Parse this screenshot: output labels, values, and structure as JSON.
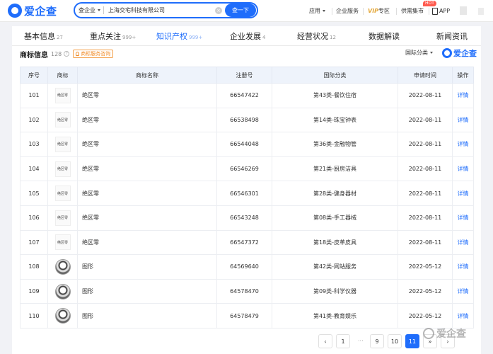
{
  "header": {
    "logo": "爱企查",
    "search_type": "查企业",
    "search_value": "上海交宅科技有限公司",
    "search_button": "查一下",
    "nav": {
      "apps": "应用",
      "enterprise_service": "企业服务",
      "vip": "VIP",
      "vip_zone": "专区",
      "supply_market": "供需集市",
      "hot_badge": "HOT",
      "app": "APP"
    }
  },
  "tabs": [
    {
      "label": "基本信息",
      "count": "27"
    },
    {
      "label": "重点关注",
      "count": "999+"
    },
    {
      "label": "知识产权",
      "count": "999+",
      "active": true
    },
    {
      "label": "企业发展",
      "count": "4"
    },
    {
      "label": "经营状况",
      "count": "12"
    },
    {
      "label": "数据解读",
      "count": ""
    },
    {
      "label": "新闻资讯",
      "count": ""
    }
  ],
  "section": {
    "title": "商标信息",
    "count": "128",
    "consult_tag": "商标服务咨询",
    "filter_label": "国际分类",
    "brand": "爱企查"
  },
  "table": {
    "columns": [
      "序号",
      "商标",
      "商标名称",
      "注册号",
      "国际分类",
      "申请时间",
      "操作"
    ],
    "rows": [
      {
        "index": "101",
        "logo_text": "绝区零",
        "logo_type": "text",
        "name": "绝区零",
        "reg_no": "66547422",
        "class": "第43类-餐饮住宿",
        "date": "2022-08-11",
        "action": "详情"
      },
      {
        "index": "102",
        "logo_text": "绝区零",
        "logo_type": "text",
        "name": "绝区零",
        "reg_no": "66538498",
        "class": "第14类-珠宝钟表",
        "date": "2022-08-11",
        "action": "详情"
      },
      {
        "index": "103",
        "logo_text": "绝区零",
        "logo_type": "text",
        "name": "绝区零",
        "reg_no": "66544048",
        "class": "第36类-金融物管",
        "date": "2022-08-11",
        "action": "详情"
      },
      {
        "index": "104",
        "logo_text": "绝区零",
        "logo_type": "text",
        "name": "绝区零",
        "reg_no": "66546269",
        "class": "第21类-厨房洁具",
        "date": "2022-08-11",
        "action": "详情"
      },
      {
        "index": "105",
        "logo_text": "绝区零",
        "logo_type": "text",
        "name": "绝区零",
        "reg_no": "66546301",
        "class": "第28类-健身器材",
        "date": "2022-08-11",
        "action": "详情"
      },
      {
        "index": "106",
        "logo_text": "绝区零",
        "logo_type": "text",
        "name": "绝区零",
        "reg_no": "66543248",
        "class": "第08类-手工器械",
        "date": "2022-08-11",
        "action": "详情"
      },
      {
        "index": "107",
        "logo_text": "绝区零",
        "logo_type": "text",
        "name": "绝区零",
        "reg_no": "66547372",
        "class": "第18类-皮革皮具",
        "date": "2022-08-11",
        "action": "详情"
      },
      {
        "index": "108",
        "logo_text": "",
        "logo_type": "image",
        "name": "图形",
        "reg_no": "64569640",
        "class": "第42类-网站服务",
        "date": "2022-05-12",
        "action": "详情"
      },
      {
        "index": "109",
        "logo_text": "",
        "logo_type": "image",
        "name": "图形",
        "reg_no": "64578470",
        "class": "第09类-科学仪器",
        "date": "2022-05-12",
        "action": "详情"
      },
      {
        "index": "110",
        "logo_text": "",
        "logo_type": "image",
        "name": "图形",
        "reg_no": "64578479",
        "class": "第41类-教育娱乐",
        "date": "2022-05-12",
        "action": "详情"
      }
    ]
  },
  "pagination": {
    "prev": "‹",
    "first": "1",
    "ellipsis": "···",
    "pages": [
      "9",
      "10"
    ],
    "current": "11",
    "next_jump": "»",
    "next": "›"
  },
  "watermark": "爱企查"
}
